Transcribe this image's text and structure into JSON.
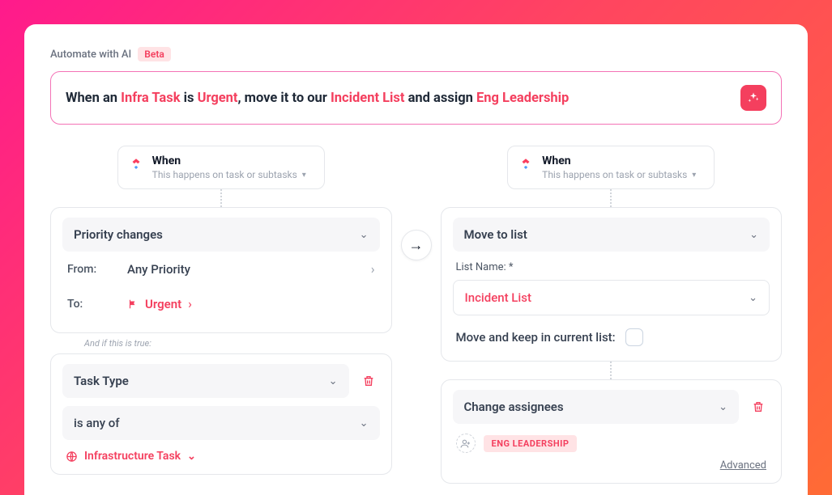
{
  "header": {
    "label": "Automate with AI",
    "beta": "Beta"
  },
  "prompt": {
    "t1": "When an ",
    "h1": "Infra Task",
    "t2": " is ",
    "h2": "Urgent",
    "t3": ", move it to our ",
    "h3": "Incident List",
    "t4": " and assign ",
    "h4": "Eng Leadership"
  },
  "trigger": {
    "title": "When",
    "subtitle": "This happens on task or subtasks",
    "event": "Priority changes",
    "from_label": "From:",
    "from_value": "Any Priority",
    "to_label": "To:",
    "to_value": "Urgent",
    "cond_intro": "And if this is true:",
    "cond_field": "Task Type",
    "cond_op": "is any of",
    "cond_value": "Infrastructure Task"
  },
  "action": {
    "title": "When",
    "subtitle": "This happens on task or subtasks",
    "move_label": "Move to list",
    "list_label": "List Name: *",
    "list_value": "Incident List",
    "keep_label": "Move and keep in current list:",
    "assign_label": "Change assignees",
    "assignee_pill": "ENG LEADERSHIP",
    "advanced": "Advanced"
  }
}
